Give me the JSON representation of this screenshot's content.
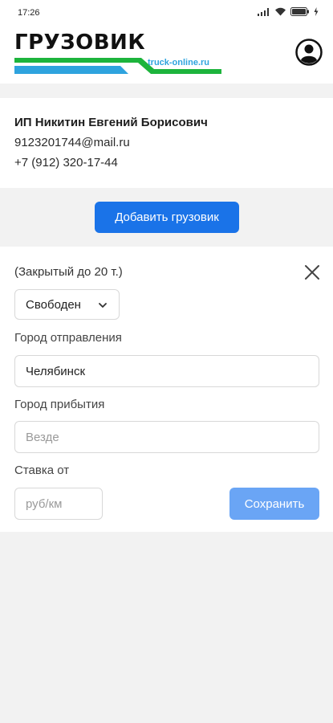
{
  "status_bar": {
    "time": "17:26",
    "icons": [
      "signal-icon",
      "wifi-icon",
      "battery-icon",
      "charging-icon"
    ]
  },
  "header": {
    "logo_title": "ГРУЗОВИК",
    "logo_subtitle": "truck-online.ru",
    "colors": {
      "green": "#1db43c",
      "blue": "#2ea3de"
    }
  },
  "profile": {
    "name": "ИП Никитин Евгений Борисович",
    "email": "9123201744@mail.ru",
    "phone": "+7 (912) 320-17-44"
  },
  "add_truck_label": "Добавить грузовик",
  "truck_form": {
    "truck_type": "(Закрытый до 20 т.)",
    "status_value": "Свободен",
    "departure_label": "Город отправления",
    "departure_value": "Челябинск",
    "arrival_label": "Город прибытия",
    "arrival_placeholder": "Везде",
    "rate_label": "Ставка от",
    "rate_placeholder": "руб/км",
    "save_label": "Сохранить"
  },
  "colors": {
    "primary": "#1a73e8",
    "primary_disabled": "#6aa5f5",
    "background": "#f2f2f2"
  }
}
